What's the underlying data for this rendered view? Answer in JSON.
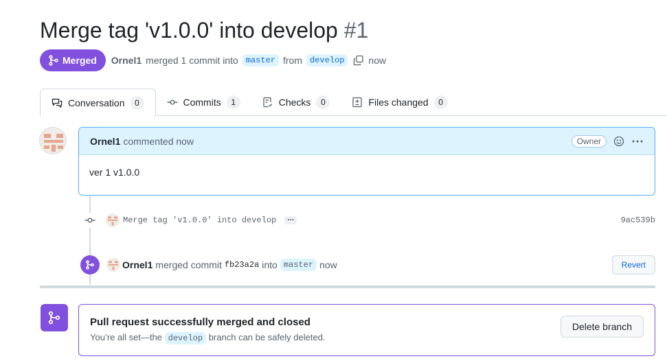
{
  "pr": {
    "title": "Merge tag 'v1.0.0' into develop",
    "number": "#1",
    "state": "Merged",
    "author": "Ornel1",
    "merge_text": "merged 1 commit into",
    "base_branch": "master",
    "from_text": "from",
    "head_branch": "develop",
    "time": "now"
  },
  "tabs": [
    {
      "label": "Conversation",
      "count": "0",
      "icon": "comment-discussion-icon"
    },
    {
      "label": "Commits",
      "count": "1",
      "icon": "git-commit-icon"
    },
    {
      "label": "Checks",
      "count": "0",
      "icon": "checklist-icon"
    },
    {
      "label": "Files changed",
      "count": "0",
      "icon": "diff-icon"
    }
  ],
  "comment": {
    "author": "Ornel1",
    "action": "commented now",
    "role": "Owner",
    "body": "ver 1 v1.0.0"
  },
  "commit": {
    "message": "Merge tag 'v1.0.0' into develop",
    "ellipsis": "…",
    "sha": "9ac539b"
  },
  "merge_event": {
    "author": "Ornel1",
    "text": "merged commit",
    "commit_sha": "fb23a2a",
    "into": "into",
    "branch": "master",
    "time": "now",
    "revert_label": "Revert"
  },
  "merged_box": {
    "title": "Pull request successfully merged and closed",
    "sub_prefix": "You’re all set—the",
    "branch": "develop",
    "sub_suffix": "branch can be safely deleted.",
    "delete_label": "Delete branch"
  },
  "colors": {
    "merged_purple": "#8250df",
    "link_blue": "#0969da",
    "comment_header_bg": "#ddf4ff"
  }
}
